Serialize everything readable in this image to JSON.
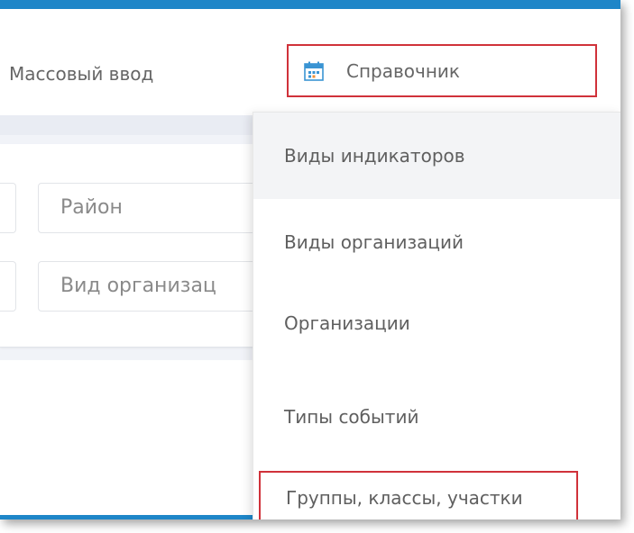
{
  "nav": {
    "mass_input": "Массовый ввод",
    "reference": "Справочник",
    "reference_icon": "calendar-icon",
    "accent_color": "#1e86c8",
    "highlight_color": "#d0323a"
  },
  "filters": {
    "district_placeholder": "Район",
    "org_type_placeholder": "Вид организац"
  },
  "dropdown": {
    "items": [
      {
        "label": "Виды индикаторов"
      },
      {
        "label": "Виды организаций"
      },
      {
        "label": "Организации"
      },
      {
        "label": "Типы событий"
      },
      {
        "label": "Группы, классы, участки"
      }
    ]
  }
}
